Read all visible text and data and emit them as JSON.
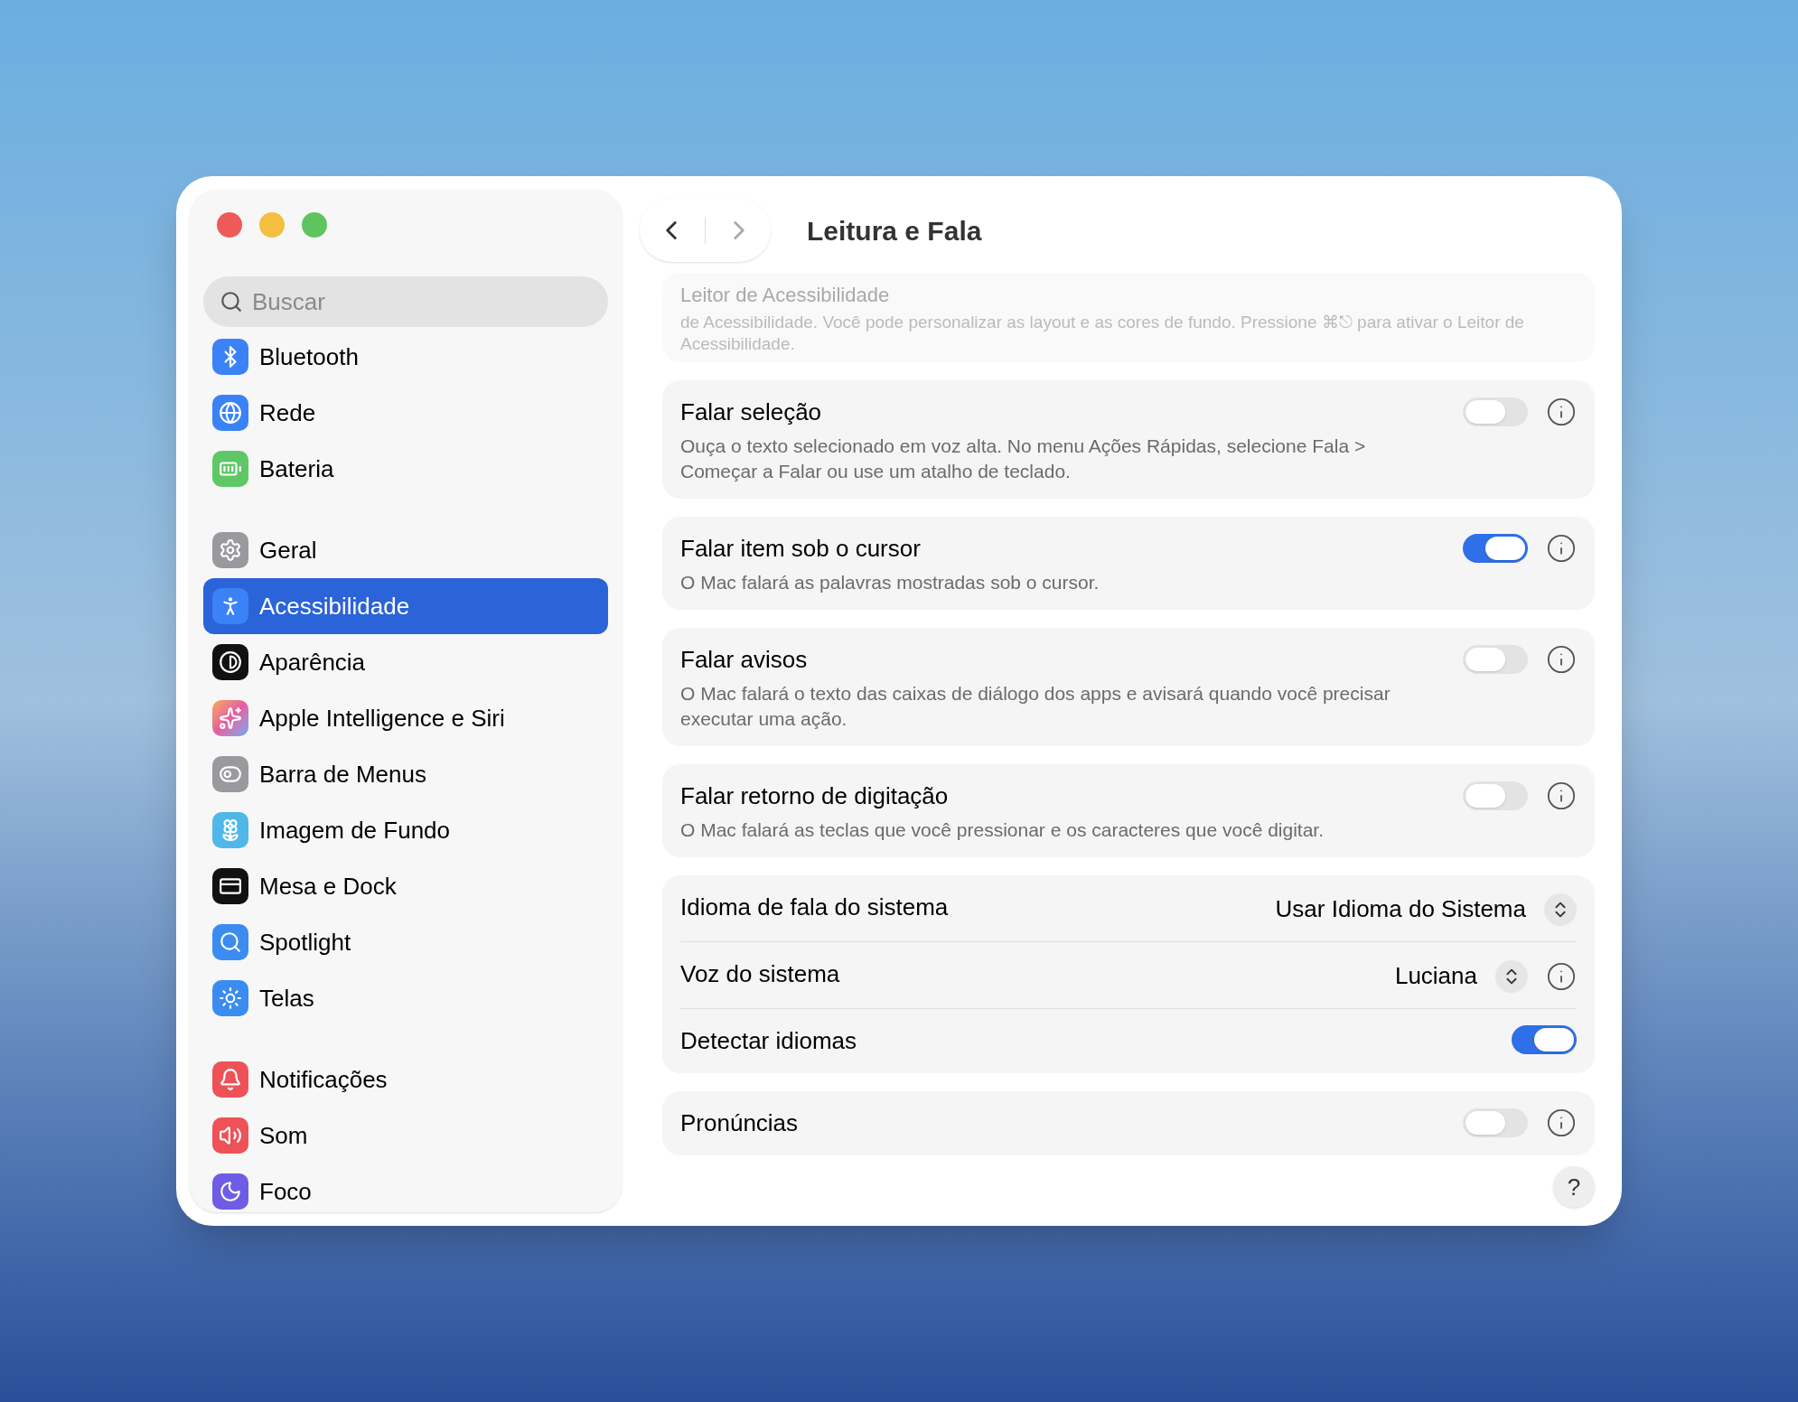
{
  "window": {
    "title": "Leitura e Fala"
  },
  "search": {
    "placeholder": "Buscar"
  },
  "sidebar": {
    "groups": [
      [
        {
          "label": "Bluetooth",
          "selected": false
        },
        {
          "label": "Rede",
          "selected": false
        },
        {
          "label": "Bateria",
          "selected": false
        }
      ],
      [
        {
          "label": "Geral",
          "selected": false
        },
        {
          "label": "Acessibilidade",
          "selected": true
        },
        {
          "label": "Aparência",
          "selected": false
        },
        {
          "label": "Apple Intelligence e Siri",
          "selected": false
        },
        {
          "label": "Barra de Menus",
          "selected": false
        },
        {
          "label": "Imagem de Fundo",
          "selected": false
        },
        {
          "label": "Mesa e Dock",
          "selected": false
        },
        {
          "label": "Spotlight",
          "selected": false
        },
        {
          "label": "Telas",
          "selected": false
        }
      ],
      [
        {
          "label": "Notificações",
          "selected": false
        },
        {
          "label": "Som",
          "selected": false
        },
        {
          "label": "Foco",
          "selected": false
        }
      ]
    ]
  },
  "scrolled_card": {
    "title": "Leitor de Acessibilidade",
    "description": "de Acessibilidade. Você pode personalizar as layout e as cores de fundo. Pressione ⌘⎋ para ativar o Leitor de Acessibilidade."
  },
  "cards": [
    {
      "rows": [
        {
          "kind": "toggle",
          "label": "Falar seleção",
          "description": "Ouça o texto selecionado em voz alta. No menu Ações Rápidas, selecione Fala > Começar a Falar ou use um atalho de teclado.",
          "on": false,
          "info": true
        }
      ]
    },
    {
      "rows": [
        {
          "kind": "toggle",
          "label": "Falar item sob o cursor",
          "description": "O Mac falará as palavras mostradas sob o cursor.",
          "on": true,
          "info": true
        }
      ]
    },
    {
      "rows": [
        {
          "kind": "toggle",
          "label": "Falar avisos",
          "description": "O Mac falará o texto das caixas de diálogo dos apps e avisará quando você precisar executar uma ação.",
          "on": false,
          "info": true
        }
      ]
    },
    {
      "rows": [
        {
          "kind": "toggle",
          "label": "Falar retorno de digitação",
          "description": "O Mac falará as teclas que você pressionar e os caracteres que você digitar.",
          "on": false,
          "info": true
        }
      ]
    },
    {
      "rows": [
        {
          "kind": "select",
          "label": "Idioma de fala do sistema",
          "value": "Usar Idioma do Sistema",
          "info": false
        },
        {
          "kind": "select",
          "label": "Voz do sistema",
          "value": "Luciana",
          "info": true
        },
        {
          "kind": "toggle",
          "label": "Detectar idiomas",
          "on": true,
          "info": false
        }
      ]
    },
    {
      "rows": [
        {
          "kind": "toggle",
          "label": "Pronúncias",
          "on": false,
          "info": true
        }
      ]
    }
  ],
  "help_button": "?"
}
